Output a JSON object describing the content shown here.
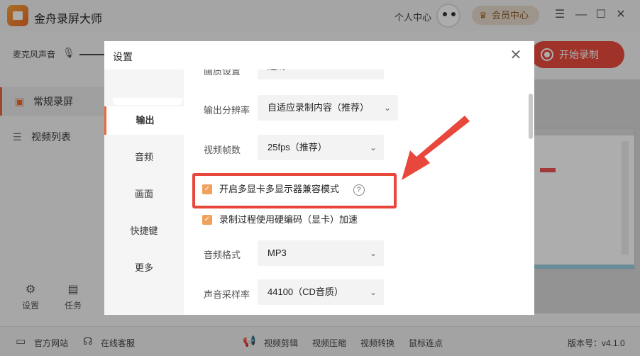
{
  "app": {
    "title": "金舟录屏大师",
    "personal_center": "个人中心",
    "vip_label": "会员中心",
    "vip_icon": "crown-icon"
  },
  "window": {
    "menu": "☰",
    "minimize": "—",
    "maximize": "☐",
    "close": "✕"
  },
  "recording": {
    "mic_label": "麦克风声音",
    "start_button": "开始录制"
  },
  "sidebar": {
    "items": [
      {
        "label": "常规录屏",
        "icon": "briefcase-icon"
      },
      {
        "label": "视频列表",
        "icon": "list-icon"
      }
    ],
    "bottom": [
      {
        "label": "设置",
        "icon": "gear-icon"
      },
      {
        "label": "任务",
        "icon": "clipboard-icon"
      }
    ]
  },
  "bottom_bar": {
    "official_site": "官方网站",
    "online_support": "在线客服",
    "tools": [
      "视频剪辑",
      "视频压缩",
      "视频转换",
      "鼠标连点"
    ],
    "version": "版本号：v4.1.0"
  },
  "dialog": {
    "title": "设置",
    "nav": [
      "输出",
      "音频",
      "画面",
      "快捷键",
      "更多"
    ],
    "active_nav": "输出",
    "settings": {
      "quality_label": "画质设置",
      "quality_value": "超清",
      "resolution_label": "输出分辨率",
      "resolution_value": "自适应录制内容（推荐）",
      "fps_label": "视频帧数",
      "fps_value": "25fps（推荐）",
      "multi_gpu_label": "开启多显卡多显示器兼容模式",
      "multi_gpu_checked": true,
      "hw_encode_label": "录制过程使用硬编码（显卡）加速",
      "hw_encode_checked": true,
      "audio_format_label": "音频格式",
      "audio_format_value": "MP3",
      "sample_rate_label": "声音采样率",
      "sample_rate_value": "44100（CD音质）"
    },
    "help_icon": "?",
    "accent_color": "#e8473c"
  }
}
